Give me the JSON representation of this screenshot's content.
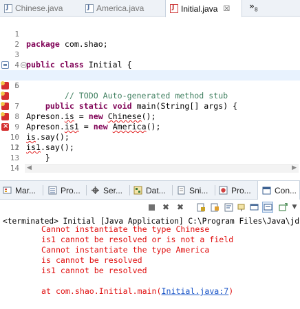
{
  "editor_tabs": [
    {
      "label": "Chinese.java",
      "active": false
    },
    {
      "label": "America.java",
      "active": false
    },
    {
      "label": "Initial.java",
      "active": true,
      "close": "☒"
    }
  ],
  "tab_overflow": {
    "label": "»",
    "count": "8"
  },
  "code_lines": [
    {
      "num": "1",
      "text": ""
    },
    {
      "num": "2",
      "text": ""
    },
    {
      "num": "3",
      "text": ""
    },
    {
      "num": "4",
      "text": ""
    },
    {
      "num": "5",
      "text": ""
    },
    {
      "num": "6",
      "text": ""
    },
    {
      "num": "7",
      "text": ""
    },
    {
      "num": "8",
      "text": ""
    },
    {
      "num": "9",
      "text": ""
    },
    {
      "num": "10",
      "text": ""
    },
    {
      "num": "11",
      "text": ""
    },
    {
      "num": "12",
      "text": ""
    },
    {
      "num": "13",
      "text": ""
    },
    {
      "num": "14",
      "text": ""
    }
  ],
  "code": {
    "l1_kw": "package",
    "l1_rest": " com.shao;",
    "l3_kw1": "public",
    "l3_kw2": "class",
    "l3_rest": " Initial {",
    "l5_kw1": "public",
    "l5_kw2": "static",
    "l5_kw3": "void",
    "l5_rest": " main(String[] args) {",
    "l6_comment": "// TODO Auto-generated method stub",
    "l7_a": "Apreson.",
    "l7_err": "is",
    "l7_b": " = ",
    "l7_kw": "new",
    "l7_sp": " ",
    "l7_err2": "Chinese",
    "l7_c": "();",
    "l8_a": "Apreson.",
    "l8_err": "is1",
    "l8_b": " = ",
    "l8_kw": "new",
    "l8_sp": " ",
    "l8_err2": "America",
    "l8_c": "();",
    "l9_err": "is",
    "l9_rest": ".say();",
    "l10_err": "is1",
    "l10_rest": ".say();",
    "l11": "}",
    "l13": "}"
  },
  "views_tabs": [
    {
      "label": "Mar..."
    },
    {
      "label": "Pro..."
    },
    {
      "label": "Ser..."
    },
    {
      "label": "Dat..."
    },
    {
      "label": "Sni..."
    },
    {
      "label": "Pro..."
    },
    {
      "label": "Con..."
    }
  ],
  "console": {
    "terminated": "<terminated> Initial [Java Application] C:\\Program Files\\Java\\jdk1.8.0_51\\bin",
    "lines": [
      "Cannot instantiate the type Chinese",
      "is1 cannot be resolved or is not a field",
      "Cannot instantiate the type America",
      "is cannot be resolved",
      "is1 cannot be resolved"
    ],
    "trace_prefix": "at com.shao.Initial.main(",
    "trace_link": "Initial.java:7",
    "trace_suffix": ")"
  },
  "colors": {
    "keyword": "#7f0055",
    "comment": "#3f7f5f",
    "error": "#e01010",
    "link": "#1a55c8",
    "highlight": "#e8f2fe"
  }
}
